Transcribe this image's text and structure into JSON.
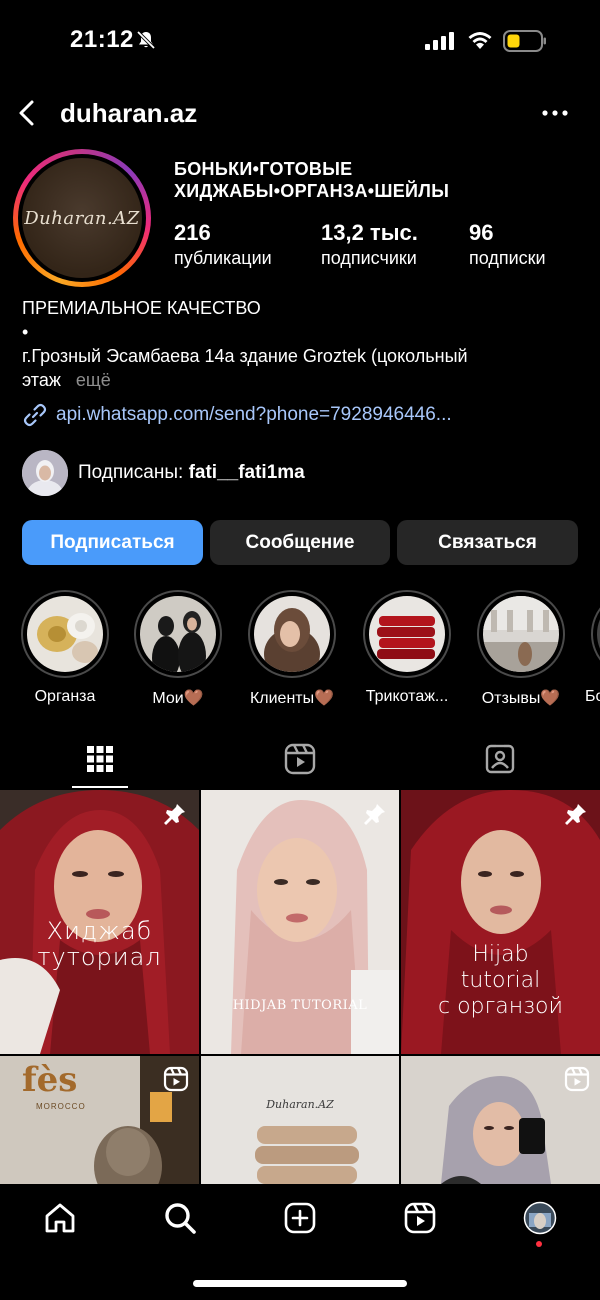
{
  "status_bar": {
    "time": "21:12"
  },
  "header": {
    "username": "duharan.az"
  },
  "profile": {
    "avatar_logo": "Duharan.AZ",
    "title_line1": "БОНЬКИ•ГОТОВЫЕ",
    "title_line2": "ХИДЖАБЫ•ОРГАНЗА•ШЕЙЛЫ",
    "stats": [
      {
        "value": "216",
        "label": "публикации"
      },
      {
        "value": "13,2 тыс.",
        "label": "подписчики"
      },
      {
        "value": "96",
        "label": "подписки"
      }
    ],
    "bio_line1": "ПРЕМИАЛЬНОЕ КАЧЕСТВО",
    "bio_line2": "•",
    "bio_line3": "г.Грозный Эсамбаева 14а здание Groztek (цокольный",
    "bio_line4": "этаж",
    "bio_more": "ещё",
    "link": "api.whatsapp.com/send?phone=7928946446...",
    "followed_prefix": "Подписаны: ",
    "followed_user": "fati__fati1ma"
  },
  "buttons": {
    "follow": "Подписаться",
    "message": "Сообщение",
    "contact": "Связаться"
  },
  "highlights": [
    {
      "label": "Органза"
    },
    {
      "label": "Мои🤎"
    },
    {
      "label": "Клиенты🤎"
    },
    {
      "label": "Трикотаж..."
    },
    {
      "label": "Отзывы🤎"
    },
    {
      "label": "Бо"
    }
  ],
  "grid": {
    "post1_caption_line1": "Хиджаб",
    "post1_caption_line2": "туториал",
    "post2_caption": "HIDJAB TUTORIAL",
    "post3_caption_line1": "Hijab",
    "post3_caption_line2": "tutorial",
    "post3_caption_line3": "с органзой",
    "post4_sign_big": "fès",
    "post4_sign_small": "MOROCCO",
    "post5_logo": "Duharan.AZ"
  },
  "colors": {
    "follow_button": "#4a9bfa",
    "secondary_button": "#262626",
    "link": "#a8c7fa",
    "notification_dot": "#ff3040"
  },
  "icons": [
    "back-icon",
    "more-icon",
    "link-icon",
    "grid-icon",
    "reels-icon",
    "tagged-icon",
    "pin-icon",
    "home-icon",
    "search-icon",
    "create-icon",
    "reels-nav-icon",
    "profile-avatar-icon"
  ]
}
